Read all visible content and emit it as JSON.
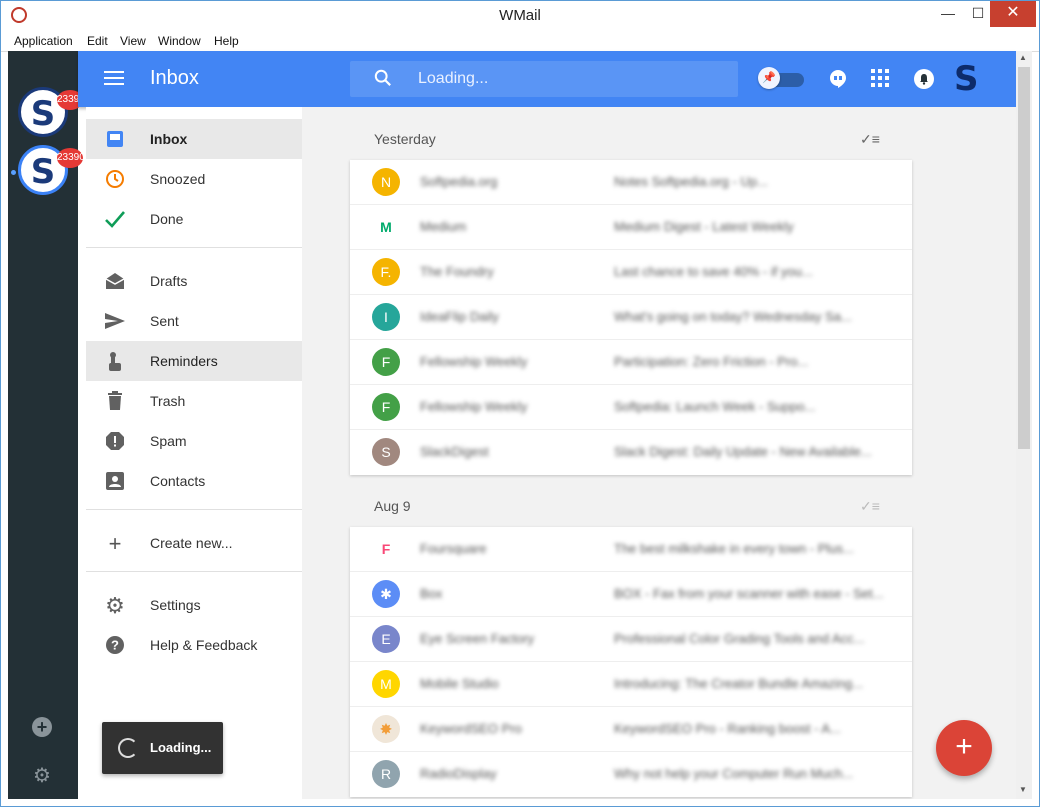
{
  "window": {
    "title": "WMail",
    "minimize": "—",
    "maximize": "☐",
    "close": "✕"
  },
  "menubar": [
    "Application",
    "Edit",
    "View",
    "Window",
    "Help"
  ],
  "accounts": [
    {
      "initial": "S",
      "badge": "23390"
    },
    {
      "initial": "S",
      "badge": "23390"
    }
  ],
  "appbar": {
    "title": "Inbox",
    "search_placeholder": "Loading...",
    "profile_initial": "S"
  },
  "sidebar": {
    "primary": [
      {
        "icon": "inbox-icon",
        "label": "Inbox",
        "active": true
      },
      {
        "icon": "clock-icon",
        "label": "Snoozed"
      },
      {
        "icon": "check-icon",
        "label": "Done"
      }
    ],
    "secondary": [
      {
        "icon": "drafts-icon",
        "label": "Drafts"
      },
      {
        "icon": "send-icon",
        "label": "Sent"
      },
      {
        "icon": "reminder-icon",
        "label": "Reminders"
      },
      {
        "icon": "trash-icon",
        "label": "Trash"
      },
      {
        "icon": "spam-icon",
        "label": "Spam"
      },
      {
        "icon": "contacts-icon",
        "label": "Contacts"
      }
    ],
    "create": {
      "icon": "plus-icon",
      "label": "Create new..."
    },
    "footer": [
      {
        "icon": "gear-icon",
        "label": "Settings"
      },
      {
        "icon": "help-icon",
        "label": "Help & Feedback"
      }
    ]
  },
  "loading_toast": "Loading...",
  "groups": [
    {
      "header": "Yesterday",
      "rows": [
        {
          "avatar": "N",
          "color": "#f5b400",
          "sender": "Softpedia.org",
          "subject": "Notes Softpedia.org - Up..."
        },
        {
          "avatar": "M",
          "color": "#ffffff",
          "sender": "Medium",
          "subject": "Medium Digest - Latest Weekly"
        },
        {
          "avatar": "F.",
          "color": "#f5b400",
          "sender": "The Foundry",
          "subject": "Last chance to save 40% - if you..."
        },
        {
          "avatar": "I",
          "color": "#26a69a",
          "sender": "IdeaFlip Daily",
          "subject": "What's going on today? Wednesday Sa..."
        },
        {
          "avatar": "F",
          "color": "#43a047",
          "sender": "Fellowship Weekly",
          "subject": "Participation: Zero Friction - Pro..."
        },
        {
          "avatar": "F",
          "color": "#43a047",
          "sender": "Fellowship Weekly",
          "subject": "Softpedia: Launch Week - Suppo..."
        },
        {
          "avatar": "S",
          "color": "#a1887f",
          "sender": "SlackDigest",
          "subject": "Slack Digest: Daily Update - New Available..."
        }
      ]
    },
    {
      "header": "Aug 9",
      "rows": [
        {
          "avatar": "F",
          "color": "#ffffff",
          "sender": "Foursquare",
          "subject": "The best milkshake in every town - Plus..."
        },
        {
          "avatar": "✱",
          "color": "#5c8df6",
          "sender": "Box",
          "subject": "BOX - Fax from your scanner with ease - Set..."
        },
        {
          "avatar": "E",
          "color": "#7986cb",
          "sender": "Eye Screen Factory",
          "subject": "Professional Color Grading Tools and Acc..."
        },
        {
          "avatar": "M",
          "color": "#ffd600",
          "sender": "Mobile Studio",
          "subject": "Introducing: The Creator Bundle Amazing..."
        },
        {
          "avatar": "✸",
          "color": "#f0e6d8",
          "sender": "KeywordSEO Pro",
          "subject": "KeywordSEO Pro - Ranking boost - A..."
        },
        {
          "avatar": "R",
          "color": "#90a4ae",
          "sender": "RadioDisplay",
          "subject": "Why not help your Computer Run Much..."
        }
      ]
    }
  ],
  "fab_label": "+"
}
